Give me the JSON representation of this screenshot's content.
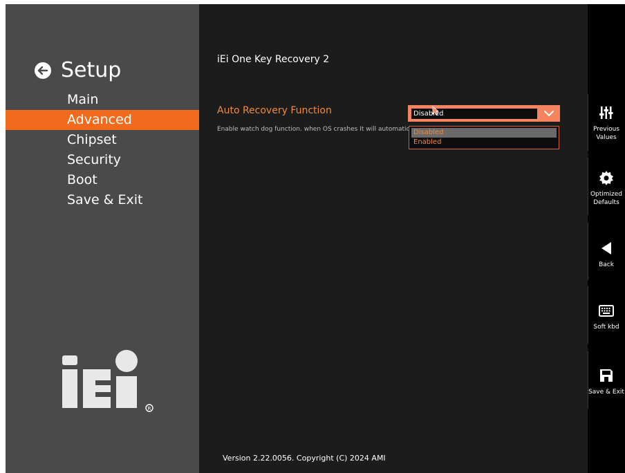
{
  "setup": {
    "title": "Setup",
    "menu": [
      "Main",
      "Advanced",
      "Chipset",
      "Security",
      "Boot",
      "Save & Exit"
    ],
    "active_index": 1
  },
  "main": {
    "section_title": "iEi One Key Recovery 2",
    "option_label": "Auto Recovery Function",
    "option_help": "Enable watch dog function. when OS crashes It will automatically recover",
    "selected_value": "Disabled",
    "options": [
      "Disabled",
      "Enabled"
    ],
    "version": "Version 2.22.0056. Copyright (C) 2024 AMI"
  },
  "toolbar": {
    "previous_line1": "Previous",
    "previous_line2": "Values",
    "optimized_line1": "Optimized",
    "optimized_line2": "Defaults",
    "back": "Back",
    "soft_kbd": "Soft kbd",
    "save_exit": "Save & Exit"
  },
  "colors": {
    "accent": "#f26b1d",
    "option_text": "#f28a3a",
    "select_border": "#f4845f",
    "panel": "#4a4a4a",
    "background": "#1c1c1c"
  },
  "icons": [
    "back-arrow-icon",
    "chevron-down-icon",
    "sliders-icon",
    "gear-icon",
    "triangle-left-icon",
    "keyboard-icon",
    "floppy-disk-icon"
  ]
}
